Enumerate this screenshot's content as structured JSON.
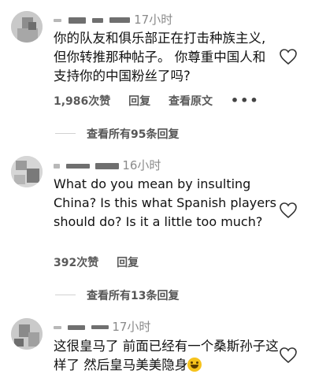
{
  "comments": [
    {
      "time": "17小时",
      "text": "你的队友和俱乐部正在打击种族主义,但你转推那种帖子。 你尊重中国人和支持你的中国粉丝了吗?",
      "actions": {
        "views": "1,986次赞",
        "reply": "回复",
        "translate": "查看原文",
        "more": "•••"
      },
      "view_replies": "查看所有95条回复"
    },
    {
      "time": "16小时",
      "text": "What do you mean by insulting China? Is this what Spanish players should do? Is it a little too much?",
      "actions": {
        "views": "392次赞",
        "reply": "回复"
      },
      "view_replies": "查看所有13条回复"
    },
    {
      "time": "17小时",
      "text": "这很皇马了 前面已经有一个桑斯孙子这样了 然后皇马美美隐身"
    }
  ],
  "colors": {
    "avatar_bg": "#cfcfcf",
    "meta": "#8a8a8a",
    "accent_emoji": "#f6c21c"
  },
  "icons": [
    "heart-icon",
    "grinning-emoji-icon",
    "more-options-icon"
  ]
}
